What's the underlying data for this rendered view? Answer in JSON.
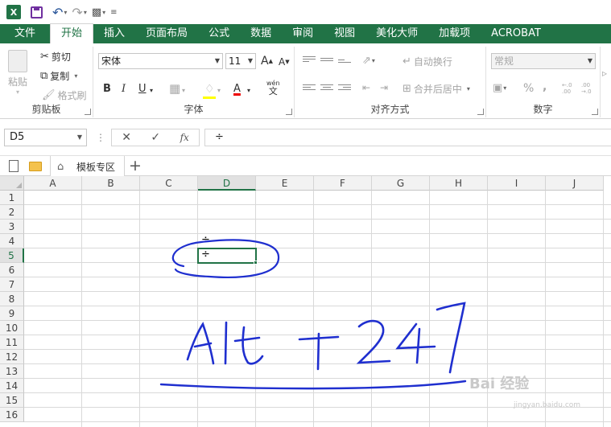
{
  "quick_access": {
    "app_icon": "excel-icon",
    "app_letter": "X"
  },
  "tabs": [
    "文件",
    "开始",
    "插入",
    "页面布局",
    "公式",
    "数据",
    "审阅",
    "视图",
    "美化大师",
    "加载项",
    "ACROBAT"
  ],
  "active_tab_index": 1,
  "ribbon": {
    "clipboard": {
      "label": "剪贴板",
      "paste": "粘贴",
      "cut": "剪切",
      "copy": "复制",
      "format_painter": "格式刷"
    },
    "font": {
      "label": "字体",
      "font_name": "宋体",
      "font_size": "11",
      "bold": "B",
      "italic": "I",
      "underline": "U",
      "grow": "A",
      "shrink": "A",
      "font_color": "A",
      "phonetic": "wén",
      "phonetic_sub": "文"
    },
    "alignment": {
      "label": "对齐方式",
      "wrap_text": "自动换行",
      "merge_center": "合并后居中"
    },
    "number": {
      "label": "数字",
      "format": "常规",
      "percent": "%",
      "comma": ",",
      "inc_decimal": "←.0 .00",
      "dec_decimal": ".00 →.0"
    }
  },
  "formula_bar": {
    "name_box": "D5",
    "cancel": "✕",
    "enter": "✓",
    "fx": "fx",
    "content": "÷"
  },
  "sheet_tabs": {
    "template_tab": "模板专区",
    "add": "+"
  },
  "grid": {
    "columns": [
      "A",
      "B",
      "C",
      "D",
      "E",
      "F",
      "G",
      "H",
      "I",
      "J"
    ],
    "rows": [
      "1",
      "2",
      "3",
      "4",
      "5",
      "6",
      "7",
      "8",
      "9",
      "10",
      "11",
      "12",
      "13",
      "14",
      "15",
      "16"
    ],
    "selected_column": "D",
    "selected_row": "5",
    "cells": {
      "D4": "÷",
      "D5": "÷"
    }
  },
  "annotation": {
    "handwriting": "Alt + 247",
    "color": "#1f2fcf"
  },
  "watermark": {
    "main": "Bai 经验",
    "sub": "jingyan.baidu.com"
  },
  "colors": {
    "excel_green": "#217346",
    "ink_blue": "#1f2fcf"
  }
}
